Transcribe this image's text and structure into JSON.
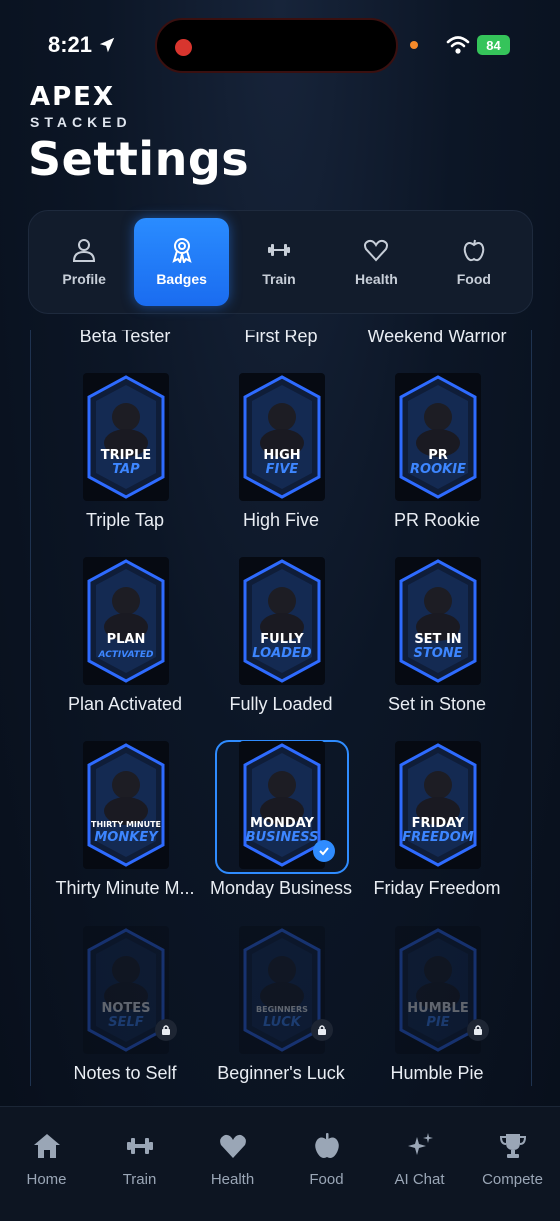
{
  "status_bar": {
    "time": "8:21",
    "battery": "84"
  },
  "brand": {
    "name": "APEX",
    "sub": "STACKED"
  },
  "page_title": "Settings",
  "tabs": [
    {
      "label": "Profile",
      "icon": "person-icon",
      "active": false
    },
    {
      "label": "Badges",
      "icon": "award-icon",
      "active": true
    },
    {
      "label": "Train",
      "icon": "dumbbell-icon",
      "active": false
    },
    {
      "label": "Health",
      "icon": "heart-icon",
      "active": false
    },
    {
      "label": "Food",
      "icon": "apple-icon",
      "active": false
    }
  ],
  "badges": {
    "top_row_labels": [
      "Beta Tester",
      "First Rep",
      "Weekend Warrior"
    ],
    "rows": [
      [
        {
          "label": "Triple Tap",
          "art": [
            "TRIPLE",
            "TAP"
          ],
          "locked": false,
          "selected": false
        },
        {
          "label": "High Five",
          "art": [
            "HIGH",
            "FIVE"
          ],
          "locked": false,
          "selected": false
        },
        {
          "label": "PR Rookie",
          "art": [
            "PR",
            "ROOKIE"
          ],
          "locked": false,
          "selected": false
        }
      ],
      [
        {
          "label": "Plan Activated",
          "art": [
            "PLAN",
            "ACTIVATED"
          ],
          "locked": false,
          "selected": false
        },
        {
          "label": "Fully Loaded",
          "art": [
            "FULLY",
            "LOADED"
          ],
          "locked": false,
          "selected": false
        },
        {
          "label": "Set in Stone",
          "art": [
            "SET IN",
            "STONE"
          ],
          "locked": false,
          "selected": false
        }
      ],
      [
        {
          "label": "Thirty Minute M...",
          "art": [
            "THIRTY MINUTE",
            "MONKEY"
          ],
          "locked": false,
          "selected": false
        },
        {
          "label": "Monday Business",
          "art": [
            "MONDAY",
            "BUSINESS"
          ],
          "locked": false,
          "selected": true
        },
        {
          "label": "Friday Freedom",
          "art": [
            "FRIDAY",
            "FREEDOM"
          ],
          "locked": false,
          "selected": false
        }
      ],
      [
        {
          "label": "Notes to Self",
          "art": [
            "NOTES",
            "SELF"
          ],
          "locked": true,
          "selected": false
        },
        {
          "label": "Beginner's Luck",
          "art": [
            "BEGINNERS",
            "LUCK"
          ],
          "locked": true,
          "selected": false
        },
        {
          "label": "Humble Pie",
          "art": [
            "HUMBLE",
            "PIE"
          ],
          "locked": true,
          "selected": false
        }
      ]
    ]
  },
  "bottom_nav": [
    {
      "label": "Home",
      "icon": "home-icon"
    },
    {
      "label": "Train",
      "icon": "dumbbell-icon"
    },
    {
      "label": "Health",
      "icon": "heart-icon"
    },
    {
      "label": "Food",
      "icon": "apple-icon"
    },
    {
      "label": "AI Chat",
      "icon": "sparkles-icon"
    },
    {
      "label": "Compete",
      "icon": "trophy-icon"
    }
  ],
  "colors": {
    "accent": "#2a8cff",
    "background": "#0a1322",
    "badge_blue": "#2e6bff"
  }
}
